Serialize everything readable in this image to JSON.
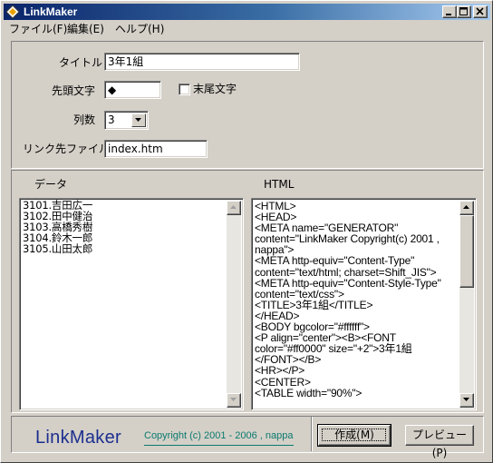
{
  "window": {
    "title": "LinkMaker"
  },
  "menu": {
    "file": "ファイル(F)",
    "edit": "編集(E)",
    "help": "ヘルプ(H)"
  },
  "form": {
    "title_label": "タイトル",
    "title_value": "3年1組",
    "prefix_label": "先頭文字",
    "prefix_value": "◆",
    "suffix_checkbox_label": "末尾文字",
    "suffix_checked": false,
    "columns_label": "列数",
    "columns_value": "3",
    "link_file_label": "リンク先ファイル",
    "link_file_value": "index.htm"
  },
  "data_panel": {
    "label": "データ",
    "lines": [
      "3101.吉田広一",
      "3102.田中健治",
      "3103.高橋秀樹",
      "3104.鈴木一郎",
      "3105.山田太郎"
    ]
  },
  "html_panel": {
    "label": "HTML",
    "lines": [
      "<HTML>",
      "<HEAD>",
      "<META name=\"GENERATOR\"",
      "content=\"LinkMaker Copyright(c) 2001 ,",
      "nappa\">",
      "<META http-equiv=\"Content-Type\"",
      "content=\"text/html; charset=Shift_JIS\">",
      "<META http-equiv=\"Content-Style-Type\"",
      "content=\"text/css\">",
      "<TITLE>3年1組</TITLE>",
      "</HEAD>",
      "<BODY bgcolor=\"#ffffff\">",
      "<P align=\"center\"><B><FONT",
      "color=\"#ff0000\" size=\"+2\">3年1組",
      "</FONT></B>",
      "<HR></P>",
      "<CENTER>",
      "<TABLE width=\"90%\">"
    ]
  },
  "footer": {
    "brand": "LinkMaker",
    "copyright": "Copyright (c) 2001 - 2006 , nappa",
    "create_button": "作成(M)",
    "preview_button": "プレビュー(P)"
  },
  "colors": {
    "titlebar_start": "#0a246a",
    "titlebar_end": "#a6caf0",
    "face": "#d4d0c8",
    "brand": "#1c2e8f",
    "copyright": "#0a7a6e"
  }
}
